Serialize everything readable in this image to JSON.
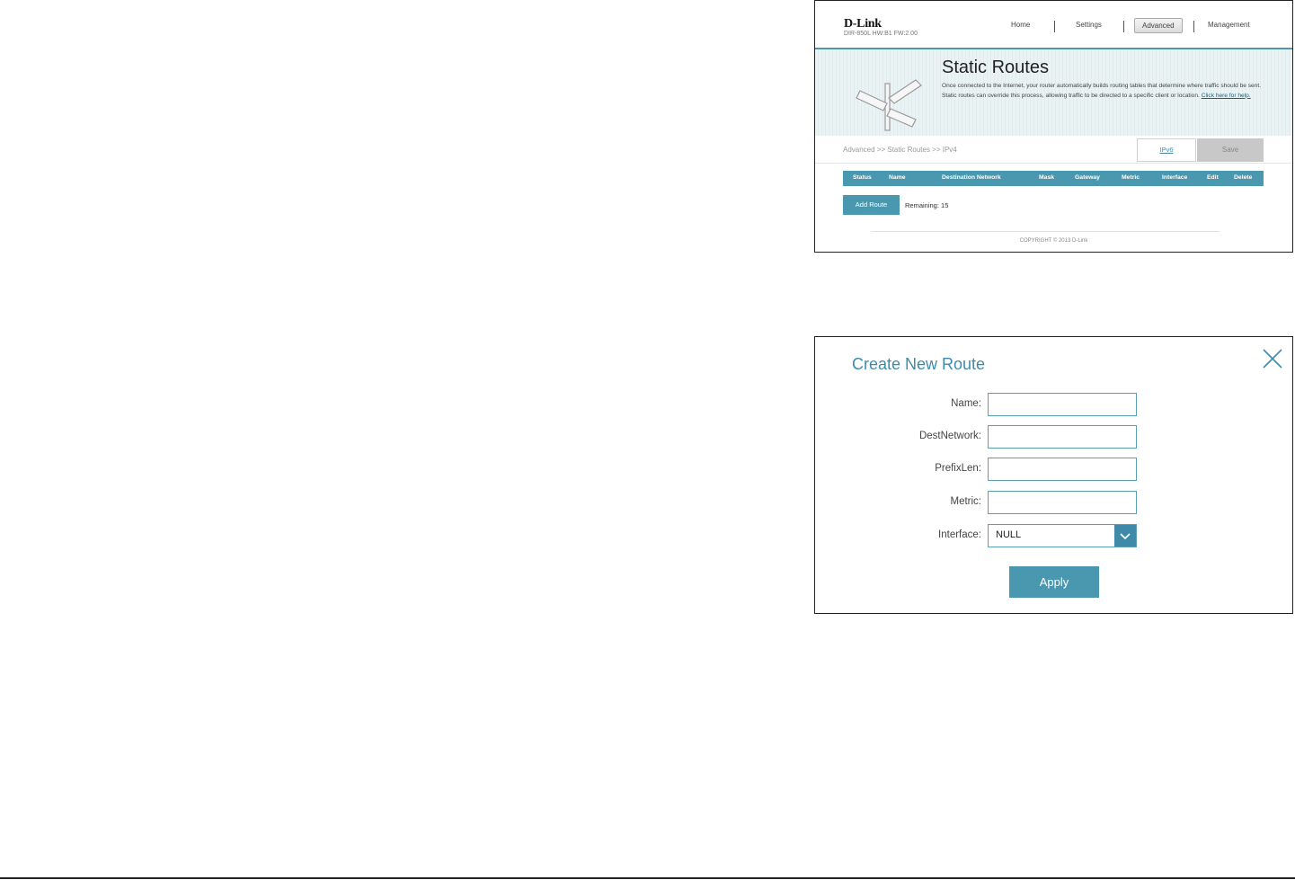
{
  "router": {
    "logo": "D-Link",
    "model": "DIR-850L   HW:B1   FW:2.00",
    "nav": {
      "home": "Home",
      "settings": "Settings",
      "advanced": "Advanced",
      "management": "Management"
    },
    "title": "Static Routes",
    "description": "Once connected to the Internet, your router automatically builds routing tables that determine where traffic should be sent. Static routes can override this process, allowing traffic to be directed to a specific client or location.",
    "help_link": "Click here for help.",
    "breadcrumb": "Advanced >> Static Routes >> IPv4",
    "ipv6_button": "IPv6",
    "save_button": "Save",
    "table_headers": [
      "Status",
      "Name",
      "Destination Network",
      "Mask",
      "Gateway",
      "Metric",
      "Interface",
      "Edit",
      "Delete"
    ],
    "add_route_button": "Add Route",
    "remaining": "Remaining: 15",
    "copyright": "COPYRIGHT © 2013 D-Link"
  },
  "dialog": {
    "title": "Create New Route",
    "fields": {
      "name": {
        "label": "Name:",
        "value": ""
      },
      "destnetwork": {
        "label": "DestNetwork:",
        "value": ""
      },
      "prefixlen": {
        "label": "PrefixLen:",
        "value": ""
      },
      "metric": {
        "label": "Metric:",
        "value": ""
      },
      "interface": {
        "label": "Interface:",
        "value": "NULL"
      }
    },
    "apply_button": "Apply"
  },
  "colors": {
    "accent": "#4a98b0",
    "title_blue": "#3d8cab",
    "border": "#222222"
  },
  "icons": {
    "close": "close-x-icon",
    "dropdown": "chevron-down-icon",
    "banner": "signpost-icon"
  }
}
